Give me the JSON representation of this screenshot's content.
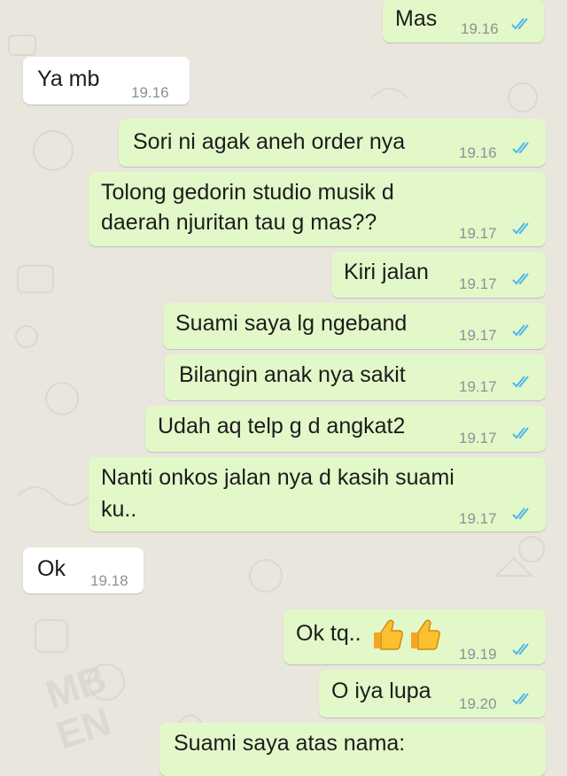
{
  "theme": {
    "wallpaper": "#e9e6dd",
    "outgoing_bubble": "#e2f8c9",
    "incoming_bubble": "#ffffff",
    "timestamp": "#8a9296",
    "read_ticks": "#4fb6ec"
  },
  "messages": [
    {
      "dir": "out",
      "text": "Mas",
      "time": "19.16",
      "status": "read"
    },
    {
      "dir": "in",
      "text": "Ya mb",
      "time": "19.16"
    },
    {
      "dir": "out",
      "text": "Sori ni agak aneh order nya",
      "time": "19.16",
      "status": "read"
    },
    {
      "dir": "out",
      "lines": [
        "Tolong gedorin studio musik d",
        "daerah njuritan tau g mas??"
      ],
      "time": "19.17",
      "status": "read"
    },
    {
      "dir": "out",
      "text": "Kiri jalan",
      "time": "19.17",
      "status": "read"
    },
    {
      "dir": "out",
      "text": "Suami saya lg ngeband",
      "time": "19.17",
      "status": "read"
    },
    {
      "dir": "out",
      "text": "Bilangin anak nya sakit",
      "time": "19.17",
      "status": "read"
    },
    {
      "dir": "out",
      "text": "Udah aq telp g d angkat2",
      "time": "19.17",
      "status": "read"
    },
    {
      "dir": "out",
      "lines": [
        "Nanti onkos jalan nya d kasih suami",
        "ku.."
      ],
      "time": "19.17",
      "status": "read"
    },
    {
      "dir": "in",
      "text": "Ok",
      "time": "19.18"
    },
    {
      "dir": "out",
      "text": "Ok tq..",
      "emoji": "thumbs-up-icon x2",
      "time": "19.19",
      "status": "read"
    },
    {
      "dir": "out",
      "text": "O iya lupa",
      "time": "19.20",
      "status": "read"
    },
    {
      "dir": "out",
      "text": "Suami saya atas nama:",
      "status": "read"
    }
  ]
}
